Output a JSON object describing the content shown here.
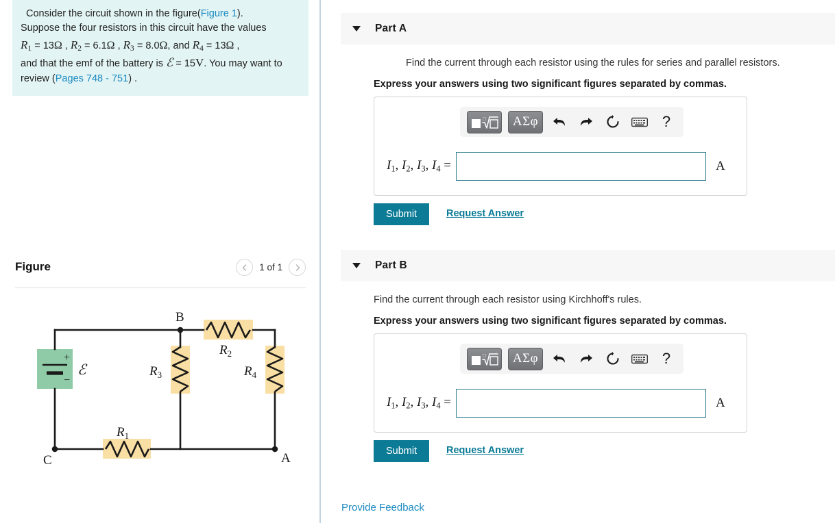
{
  "problem": {
    "line1_a": "Consider the circuit shown in the figure(",
    "figure_link": "Figure 1",
    "line1_b": ").",
    "line2": "Suppose the four resistors in this circuit have the values",
    "r1_sym": "R",
    "r1_sub": "1",
    "r1_eq": "= 13",
    "r1_unit": "Ω",
    "r2_sym": "R",
    "r2_sub": "2",
    "r2_eq": "= 6.1",
    "r2_unit": "Ω",
    "r3_sym": "R",
    "r3_sub": "3",
    "r3_eq": "= 8.0",
    "r3_unit": "Ω",
    "and_word": ", and",
    "r4_sym": "R",
    "r4_sub": "4",
    "r4_eq": "= 13",
    "r4_unit": "Ω",
    "emf_text": "and that the emf of the battery is",
    "emf_sym": "ℰ",
    "emf_eq": "= 15",
    "emf_unit": "V",
    "review_text": ". You may want to review (",
    "pages_link": "Pages 748 - 751",
    "review_tail": ") ."
  },
  "figure": {
    "title": "Figure",
    "count": "1 of 1",
    "prev_icon": "chevron-left-icon",
    "next_icon": "chevron-right-icon",
    "circuit": {
      "node_b": "B",
      "node_c": "C",
      "node_a": "A",
      "battery_label": "ℰ",
      "battery_plus": "+",
      "battery_minus": "−",
      "r1_label": "R",
      "r1_sub": "1",
      "r2_label": "R",
      "r2_sub": "2",
      "r3_label": "R",
      "r3_sub": "3",
      "r4_label": "R",
      "r4_sub": "4",
      "resistor_highlight": "#fadfa4",
      "battery_highlight": "#8fcba6",
      "wire_color": "#1a1a1a"
    }
  },
  "parts": [
    {
      "label": "Part A",
      "caret_icon": "caret-down-icon",
      "prompt": "Find the current through each resistor using the rules for series and parallel resistors.",
      "express": "Express your answers using two significant figures separated by commas.",
      "answer_label_prefix": "I",
      "answer_label_full": "I₁, I₂, I₃, I₄ =",
      "answer_value": "",
      "answer_placeholder": "",
      "unit": "A",
      "submit_label": "Submit",
      "request_label": "Request Answer",
      "toolbar": {
        "template_icon": "math-template-icon",
        "greek_label": "ΑΣφ",
        "undo_icon": "undo-arrow-icon",
        "redo_icon": "redo-arrow-icon",
        "reset_icon": "reset-circle-icon",
        "keyboard_icon": "keyboard-icon",
        "help_label": "?"
      }
    },
    {
      "label": "Part B",
      "caret_icon": "caret-down-icon",
      "prompt": "Find the current through each resistor using Kirchhoff's rules.",
      "express": "Express your answers using two significant figures separated by commas.",
      "answer_label_prefix": "I",
      "answer_label_full": "I₁, I₂, I₃, I₄ =",
      "answer_value": "",
      "answer_placeholder": "",
      "unit": "A",
      "submit_label": "Submit",
      "request_label": "Request Answer",
      "toolbar": {
        "template_icon": "math-template-icon",
        "greek_label": "ΑΣφ",
        "undo_icon": "undo-arrow-icon",
        "redo_icon": "redo-arrow-icon",
        "reset_icon": "reset-circle-icon",
        "keyboard_icon": "keyboard-icon",
        "help_label": "?"
      }
    }
  ],
  "footer": {
    "feedback_label": "Provide Feedback"
  },
  "colors": {
    "accent_teal": "#0b7b96",
    "link_blue": "#1a8ac0",
    "problem_bg": "#e3f4f4",
    "part_header_bg": "#f7f7f7",
    "input_border": "#2c7a8c"
  }
}
